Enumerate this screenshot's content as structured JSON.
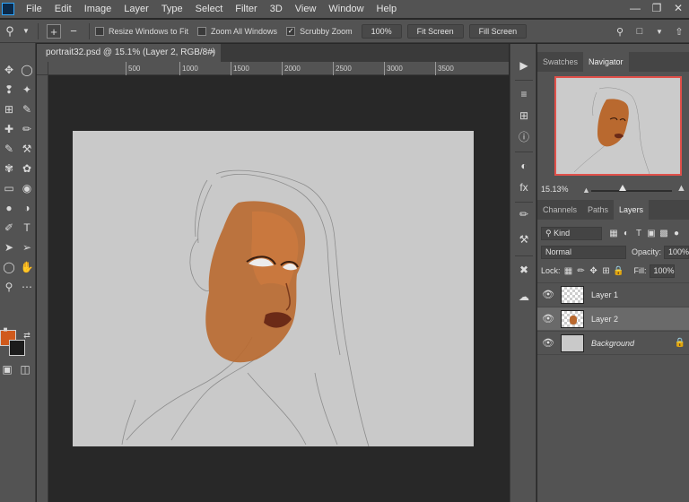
{
  "menubar": {
    "items": [
      "File",
      "Edit",
      "Image",
      "Layer",
      "Type",
      "Select",
      "Filter",
      "3D",
      "View",
      "Window",
      "Help"
    ],
    "controls": [
      "—",
      "❐",
      "✕"
    ]
  },
  "options": {
    "resize_windows": "Resize Windows to Fit",
    "zoom_all": "Zoom All Windows",
    "scrubby_zoom": "Scrubby Zoom",
    "zoom_value": "100%",
    "fit_screen": "Fit Screen",
    "fill_screen": "Fill Screen"
  },
  "document": {
    "tab_title": "portrait32.psd @ 15.1% (Layer 2, RGB/8#) *",
    "close": "×",
    "ruler_ticks": [
      "500",
      "1000",
      "1500",
      "2000",
      "2500",
      "3000",
      "3500"
    ]
  },
  "colors": {
    "foreground": "#d05a1c",
    "background": "#1c1c1c",
    "navigator_border": "#e0504a"
  },
  "panels": {
    "top_tabs": [
      "Swatches",
      "Navigator"
    ],
    "zoom_percent": "15.13%",
    "layer_tabs": [
      "Channels",
      "Paths",
      "Layers"
    ],
    "kind_label": "Kind",
    "blend_mode": "Normal",
    "opacity_label": "Opacity:",
    "opacity_value": "100%",
    "lock_label": "Lock:",
    "fill_label": "Fill:",
    "fill_value": "100%",
    "layers": [
      {
        "name": "Layer 1",
        "selected": false
      },
      {
        "name": "Layer 2",
        "selected": true
      },
      {
        "name": "Background",
        "selected": false,
        "locked": true
      }
    ]
  }
}
